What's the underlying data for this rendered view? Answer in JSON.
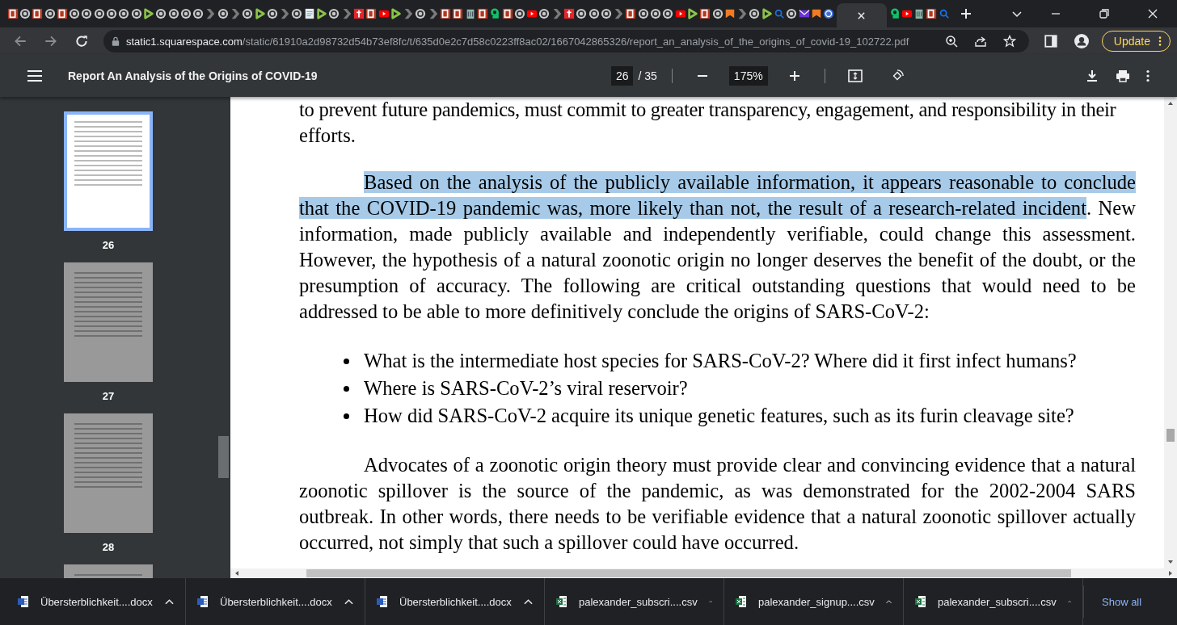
{
  "tabs": [
    {
      "kind": "b",
      "selected": false
    },
    {
      "kind": "c",
      "selected": false
    },
    {
      "kind": "b",
      "selected": false
    },
    {
      "kind": "c",
      "selected": false
    },
    {
      "kind": "b",
      "selected": false
    },
    {
      "kind": "c",
      "selected": false
    },
    {
      "kind": "c",
      "selected": false
    },
    {
      "kind": "c",
      "selected": false
    },
    {
      "kind": "c",
      "selected": false
    },
    {
      "kind": "c",
      "selected": false
    },
    {
      "kind": "c",
      "selected": false
    },
    {
      "kind": "d",
      "selected": false
    },
    {
      "kind": "c",
      "selected": false
    },
    {
      "kind": "c",
      "selected": false
    },
    {
      "kind": "c",
      "selected": false
    },
    {
      "kind": "c",
      "selected": false
    },
    {
      "kind": "a",
      "selected": false
    },
    {
      "kind": "c",
      "selected": false
    },
    {
      "kind": "a",
      "selected": false
    },
    {
      "kind": "c",
      "selected": false
    },
    {
      "kind": "d",
      "selected": false
    },
    {
      "kind": "c",
      "selected": false
    },
    {
      "kind": "a",
      "selected": false
    },
    {
      "kind": "c",
      "selected": false
    },
    {
      "kind": "w",
      "selected": false
    },
    {
      "kind": "d",
      "selected": false
    },
    {
      "kind": "c",
      "selected": false
    },
    {
      "kind": "a",
      "selected": false
    },
    {
      "kind": "r",
      "selected": false
    },
    {
      "kind": "b",
      "selected": false
    },
    {
      "kind": "y",
      "selected": false
    },
    {
      "kind": "d",
      "selected": false
    },
    {
      "kind": "a",
      "selected": false
    },
    {
      "kind": "c",
      "selected": false
    },
    {
      "kind": "a",
      "selected": false
    },
    {
      "kind": "b",
      "selected": false
    },
    {
      "kind": "b",
      "selected": false
    },
    {
      "kind": "t",
      "selected": false
    },
    {
      "kind": "b",
      "selected": false
    },
    {
      "kind": "g",
      "selected": false
    },
    {
      "kind": "b",
      "selected": false
    },
    {
      "kind": "c",
      "selected": false
    },
    {
      "kind": "y",
      "selected": false
    },
    {
      "kind": "c",
      "selected": false
    },
    {
      "kind": "a",
      "selected": false
    },
    {
      "kind": "r",
      "selected": false
    },
    {
      "kind": "c",
      "selected": false
    },
    {
      "kind": "c",
      "selected": false
    },
    {
      "kind": "c",
      "selected": false
    },
    {
      "kind": "a",
      "selected": false
    },
    {
      "kind": "b",
      "selected": false
    },
    {
      "kind": "c",
      "selected": false
    },
    {
      "kind": "c",
      "selected": false
    },
    {
      "kind": "c",
      "selected": false
    },
    {
      "kind": "y",
      "selected": false
    },
    {
      "kind": "d",
      "selected": false
    },
    {
      "kind": "b",
      "selected": false
    },
    {
      "kind": "c",
      "selected": false
    },
    {
      "kind": "o",
      "selected": false
    },
    {
      "kind": "a",
      "selected": false
    },
    {
      "kind": "c",
      "selected": false
    },
    {
      "kind": "d",
      "selected": false
    },
    {
      "kind": "s",
      "selected": false
    },
    {
      "kind": "c",
      "selected": false
    },
    {
      "kind": "m",
      "selected": false
    },
    {
      "kind": "o",
      "selected": false
    },
    {
      "kind": "u",
      "selected": false
    },
    {
      "selected": true
    },
    {
      "kind": "g",
      "selected": false
    },
    {
      "kind": "y",
      "selected": false
    },
    {
      "kind": "t",
      "selected": false
    },
    {
      "kind": "b",
      "selected": false
    },
    {
      "kind": "s",
      "selected": false
    }
  ],
  "address_bar": {
    "host": "static1.squarespace.com",
    "path": "/static/61910a2d98732d54b73ef8fc/t/635d0e2c7d58c0223ff8ac02/1667042865326/report_an_analysis_of_the_origins_of_covid-19_102722.pdf"
  },
  "update_button": "Update",
  "pdf_toolbar": {
    "title": "Report An Analysis of the Origins of COVID-19",
    "page": "26",
    "page_total": "/ 35",
    "zoom": "175%"
  },
  "thumbnails": [
    {
      "label": "26",
      "selected": true
    },
    {
      "label": "27",
      "selected": false
    },
    {
      "label": "28",
      "selected": false
    },
    {
      "selected": false
    }
  ],
  "document": [
    {
      "kind": "text",
      "text": "to prevent future pandemics, must commit to greater transparency, engagement, and responsibility in their"
    },
    {
      "kind": "text",
      "text": "efforts."
    },
    {
      "kind": "paragraph",
      "highlighted": "Based on the analysis of the publicly available information, it appears reasonable to conclude that the COVID-19 pandemic was, more likely than not, the result of a research-related incident",
      "text": ". New information, made publicly available and independently verifiable, could change this assessment. However, the hypothesis of a natural zoonotic origin no longer deserves the benefit of the doubt, or the presumption of accuracy. The following are critical outstanding questions that would need to be addressed to be able to more definitively conclude the origins of SARS-CoV-2:"
    },
    {
      "kind": "bullets",
      "items": [
        "What is the intermediate host species for SARS-CoV-2? Where did it first infect humans?",
        "Where is SARS-CoV-2’s viral reservoir?",
        "How did SARS-CoV-2 acquire its unique genetic features, such as its furin cleavage site?"
      ]
    },
    {
      "kind": "paragraph",
      "text": "Advocates of a zoonotic origin theory must provide clear and convincing evidence that a natural zoonotic spillover is the source of the pandemic, as was demonstrated for the 2002-2004 SARS outbreak. In other words, there needs to be verifiable evidence that a natural zoonotic spillover actually occurred, not simply that such a spillover could have occurred."
    }
  ],
  "downloads": [
    {
      "kind": "docx",
      "name": "Übersterblichkeit....docx"
    },
    {
      "kind": "docx",
      "name": "Übersterblichkeit....docx"
    },
    {
      "kind": "docx",
      "name": "Übersterblichkeit....docx"
    },
    {
      "kind": "csv",
      "name": "palexander_subscri....csv"
    },
    {
      "kind": "csv",
      "name": "palexander_signup....csv"
    },
    {
      "kind": "csv",
      "name": "palexander_subscri....csv"
    }
  ],
  "show_all": "Show all"
}
